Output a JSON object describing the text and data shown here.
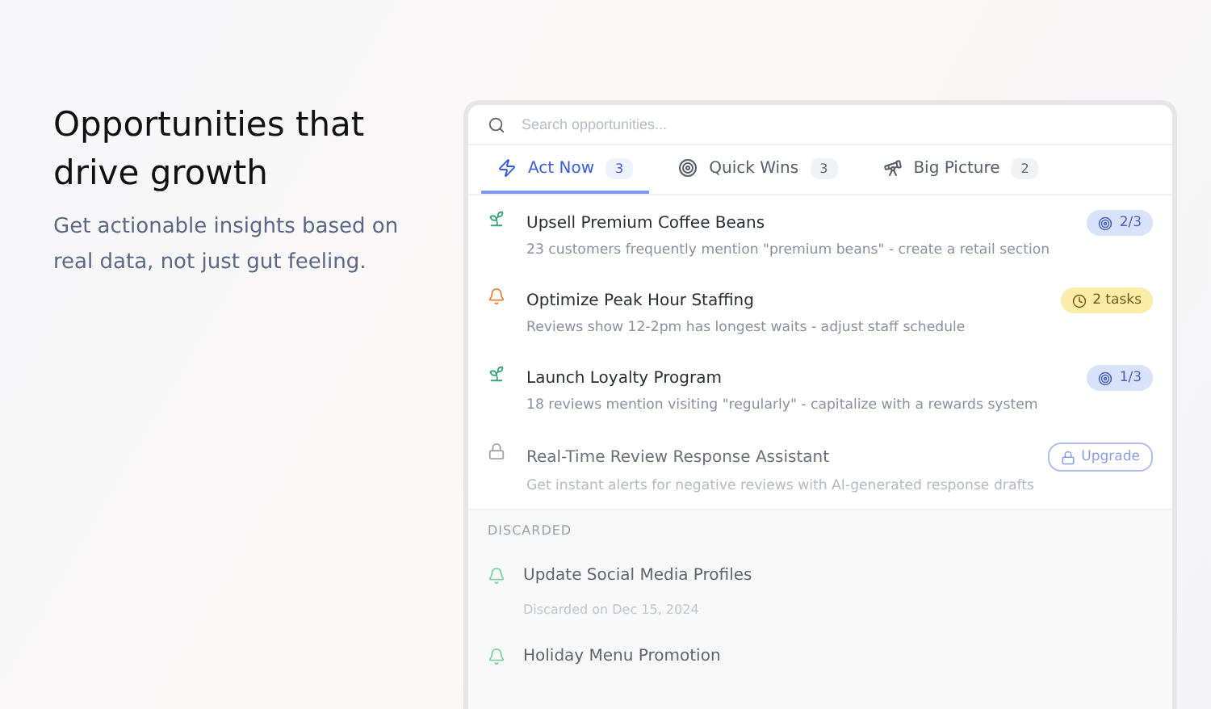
{
  "hero": {
    "title": "Opportunities that drive growth",
    "subtitle": "Get actionable insights based on real data, not just gut feeling."
  },
  "search": {
    "placeholder": "Search opportunities..."
  },
  "tabs": [
    {
      "label": "Act Now",
      "count": "3",
      "kind": "zap",
      "selected": true
    },
    {
      "label": "Quick Wins",
      "count": "3",
      "kind": "target",
      "selected": false
    },
    {
      "label": "Big Picture",
      "count": "2",
      "kind": "telescope",
      "selected": false
    }
  ],
  "items": [
    {
      "kind": "sprout",
      "title": "Upsell Premium Coffee Beans",
      "description": "23 customers frequently mention \"premium beans\" - create a retail section",
      "badge": {
        "kind": "progress",
        "label": "2/3"
      }
    },
    {
      "kind": "bell",
      "title": "Optimize Peak Hour Staffing",
      "description": "Reviews show 12-2pm has longest waits - adjust staff schedule",
      "badge": {
        "kind": "tasks",
        "label": "2 tasks"
      }
    },
    {
      "kind": "sprout",
      "title": "Launch Loyalty Program",
      "description": "18 reviews mention visiting \"regularly\" - capitalize with a rewards system",
      "badge": {
        "kind": "progress",
        "label": "1/3"
      }
    },
    {
      "kind": "locked",
      "title": "Real-Time Review Response Assistant",
      "description": "Get instant alerts for negative reviews with AI-generated response drafts",
      "badge": {
        "kind": "upgrade",
        "label": "Upgrade"
      }
    }
  ],
  "discarded": {
    "heading": "DISCARDED",
    "items": [
      {
        "title": "Update Social Media Profiles",
        "date": "Discarded on Dec 15, 2024"
      },
      {
        "title": "Holiday Menu Promotion"
      }
    ]
  }
}
